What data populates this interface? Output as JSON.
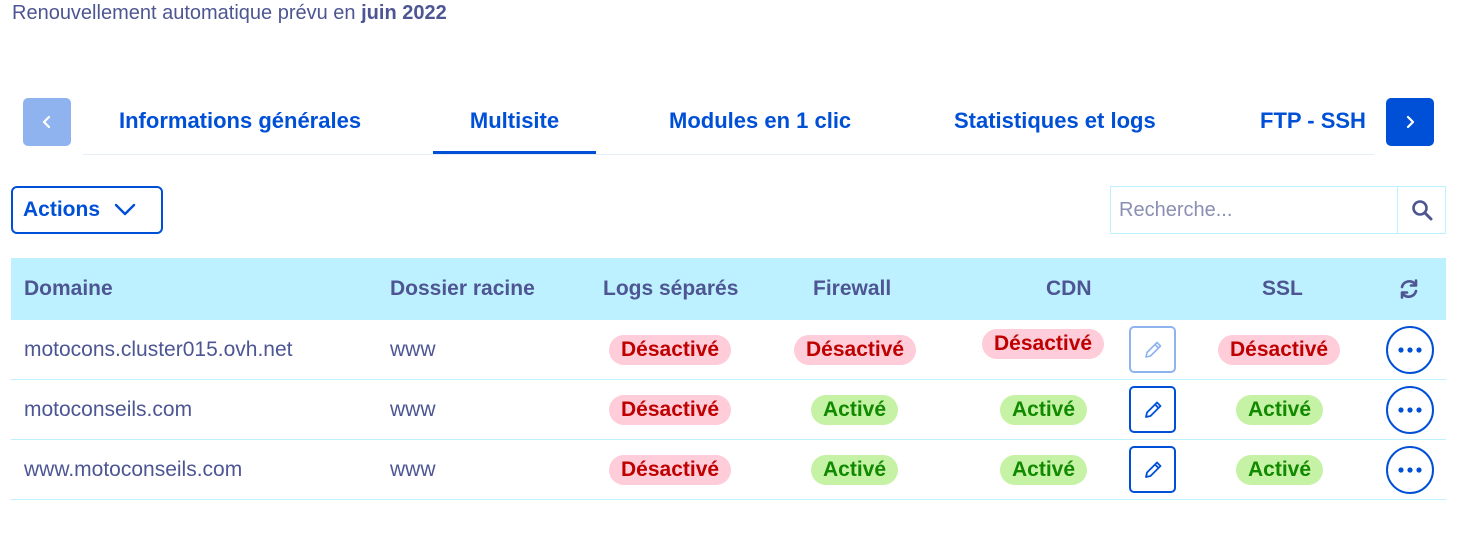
{
  "header": {
    "renewal_prefix": "Renouvellement automatique prévu en",
    "renewal_date": "juin 2022"
  },
  "tabs": {
    "items": [
      {
        "label": "Informations générales"
      },
      {
        "label": "Multisite"
      },
      {
        "label": "Modules en 1 clic"
      },
      {
        "label": "Statistiques et logs"
      },
      {
        "label": "FTP - SSH"
      }
    ],
    "active": "Multisite"
  },
  "toolbar": {
    "actions_label": "Actions",
    "search_placeholder": "Recherche..."
  },
  "table": {
    "columns": [
      "Domaine",
      "Dossier racine",
      "Logs séparés",
      "Firewall",
      "CDN",
      "SSL"
    ],
    "rows": [
      {
        "domain": "motocons.cluster015.ovh.net",
        "root": "www",
        "logs": "Désactivé",
        "firewall": "Désactivé",
        "cdn": "Désactivé",
        "cdn_edit_disabled": true,
        "ssl": "Désactivé"
      },
      {
        "domain": "motoconseils.com",
        "root": "www",
        "logs": "Désactivé",
        "firewall": "Activé",
        "cdn": "Activé",
        "cdn_edit_disabled": false,
        "ssl": "Activé"
      },
      {
        "domain": "www.motoconseils.com",
        "root": "www",
        "logs": "Désactivé",
        "firewall": "Activé",
        "cdn": "Activé",
        "cdn_edit_disabled": false,
        "ssl": "Activé"
      }
    ]
  },
  "icons": {
    "prev": "chevron-left-icon",
    "next": "chevron-right-icon",
    "actions": "chevron-down-icon",
    "search": "search-icon",
    "refresh": "refresh-icon",
    "edit": "pencil-icon",
    "more": "ellipsis-icon"
  },
  "colors": {
    "primary": "#0050d7",
    "text": "#4d5693",
    "header_bg": "#bef1ff",
    "badge_off_bg": "#ffccd9",
    "badge_off_text": "#be0000",
    "badge_on_bg": "#c6f2a6",
    "badge_on_text": "#118a00"
  }
}
